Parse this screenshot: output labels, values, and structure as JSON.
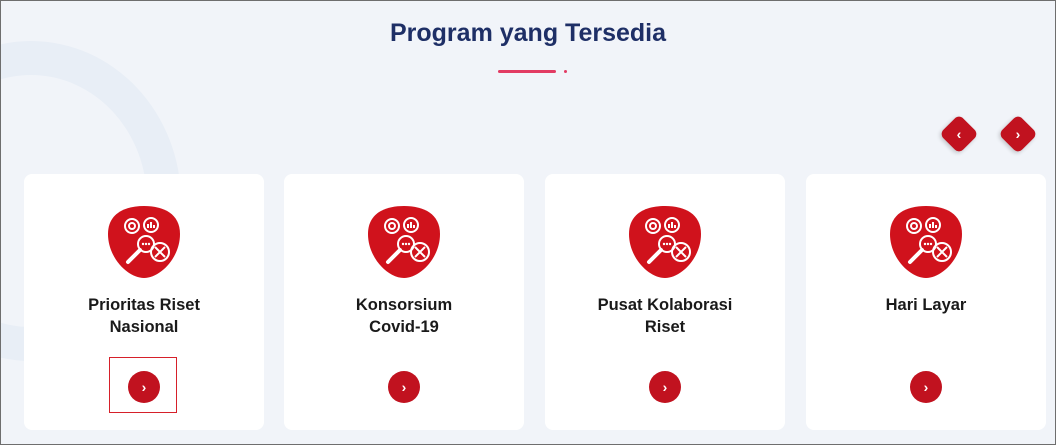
{
  "section": {
    "title": "Program yang Tersedia"
  },
  "carousel": {
    "prev_glyph": "‹",
    "next_glyph": "›"
  },
  "cards": [
    {
      "title": "Prioritas Riset\nNasional",
      "icon": "research-analytics-icon",
      "button_glyph": "›"
    },
    {
      "title": "Konsorsium\nCovid-19",
      "icon": "research-analytics-icon",
      "button_glyph": "›"
    },
    {
      "title": "Pusat Kolaborasi\nRiset",
      "icon": "research-analytics-icon",
      "button_glyph": "›"
    },
    {
      "title": "Hari Layar",
      "icon": "research-analytics-icon",
      "button_glyph": "›"
    }
  ],
  "colors": {
    "accent_red": "#c1121f",
    "title_navy": "#1e2f66",
    "underline_pink": "#e23b63",
    "background": "#f1f4f9"
  }
}
